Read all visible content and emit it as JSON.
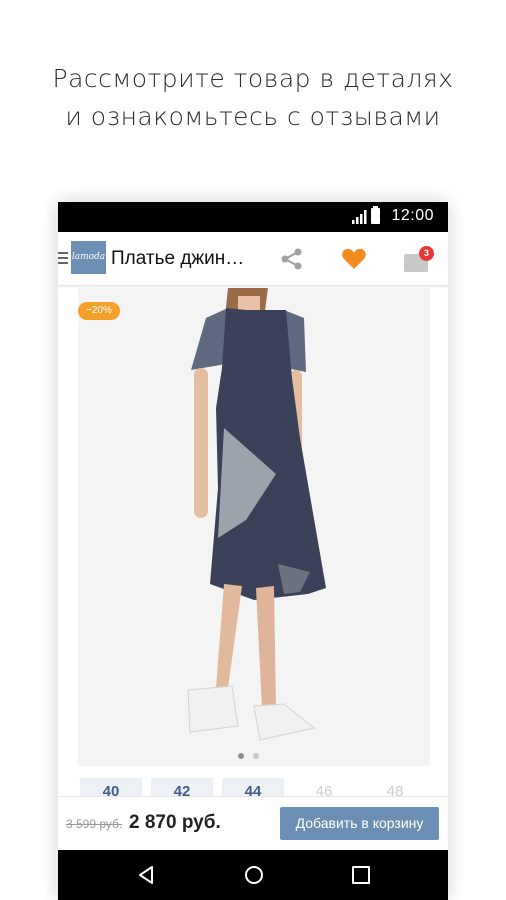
{
  "promo": {
    "line1": "Рассмотрите товар в деталях",
    "line2": "и ознакомьтесь с отзывами"
  },
  "status": {
    "time": "12:00",
    "icons": [
      "signal-icon",
      "battery-icon"
    ]
  },
  "appbar": {
    "logo_text": "lamoda",
    "title": "Платье джин…",
    "cart_count": "3",
    "icons": [
      "menu-icon",
      "share-icon",
      "heart-icon",
      "cart-icon"
    ],
    "colors": {
      "heart": "#f28c1f",
      "badge": "#e53935",
      "brand": "#6a8fb3"
    }
  },
  "product": {
    "discount_badge": "−20%",
    "sizes": [
      {
        "label": "40",
        "available": true
      },
      {
        "label": "42",
        "available": true
      },
      {
        "label": "44",
        "available": true
      },
      {
        "label": "46",
        "available": false
      },
      {
        "label": "48",
        "available": false
      }
    ],
    "old_price": "3 599 руб.",
    "new_price": "2 870 руб.",
    "add_to_cart_label": "Добавить в корзину"
  },
  "navbar": {
    "icons": [
      "back-icon",
      "home-icon",
      "recent-apps-icon"
    ]
  }
}
